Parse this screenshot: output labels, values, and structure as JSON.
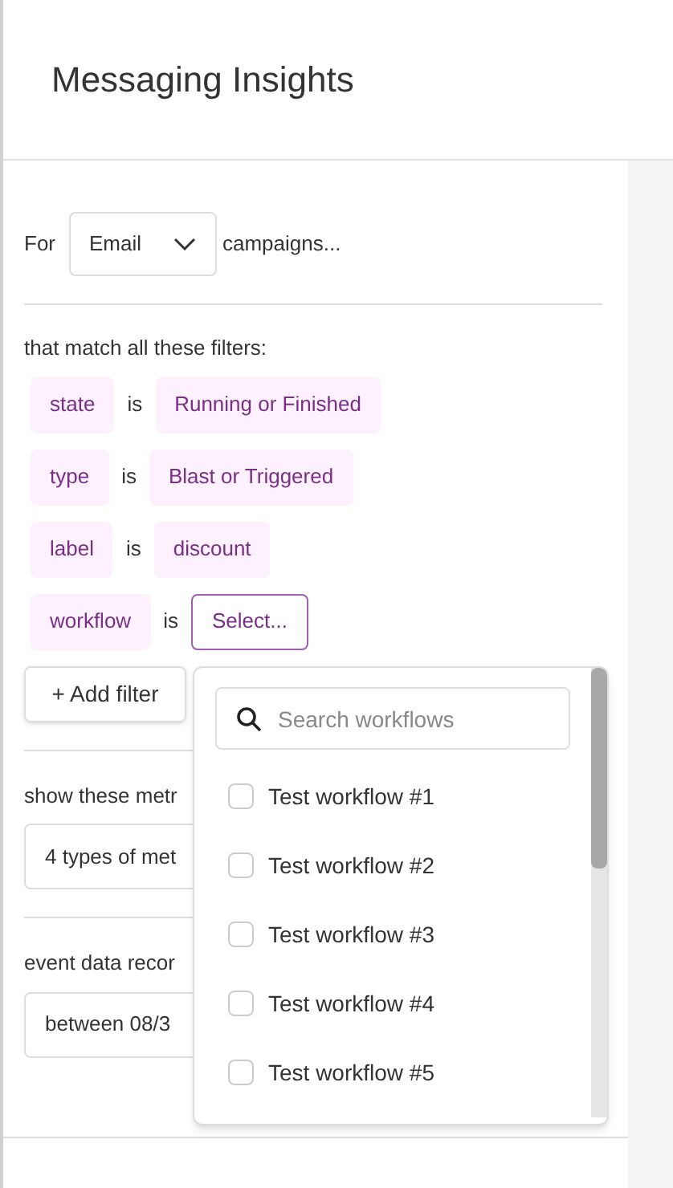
{
  "header": {
    "title": "Messaging Insights"
  },
  "channel": {
    "prefix": "For",
    "value": "Email",
    "suffix": "campaigns..."
  },
  "filters": {
    "heading": "that match all these filters:",
    "items": [
      {
        "field": "state",
        "operator": "is",
        "value": "Running or Finished",
        "kind": "chip"
      },
      {
        "field": "type",
        "operator": "is",
        "value": "Blast or Triggered",
        "kind": "chip"
      },
      {
        "field": "label",
        "operator": "is",
        "value": "discount",
        "kind": "chip"
      },
      {
        "field": "workflow",
        "operator": "is",
        "value": "Select...",
        "kind": "select"
      }
    ],
    "add_button": "+ Add filter"
  },
  "metrics": {
    "label": "show these metr",
    "value": "4 types of met"
  },
  "date_range": {
    "label": "event data recor",
    "value": "between 08/3"
  },
  "workflow_dropdown": {
    "search_placeholder": "Search workflows",
    "options": [
      {
        "label": "Test workflow #1",
        "checked": false
      },
      {
        "label": "Test workflow #2",
        "checked": false
      },
      {
        "label": "Test workflow #3",
        "checked": false
      },
      {
        "label": "Test workflow #4",
        "checked": false
      },
      {
        "label": "Test workflow #5",
        "checked": false
      }
    ]
  }
}
